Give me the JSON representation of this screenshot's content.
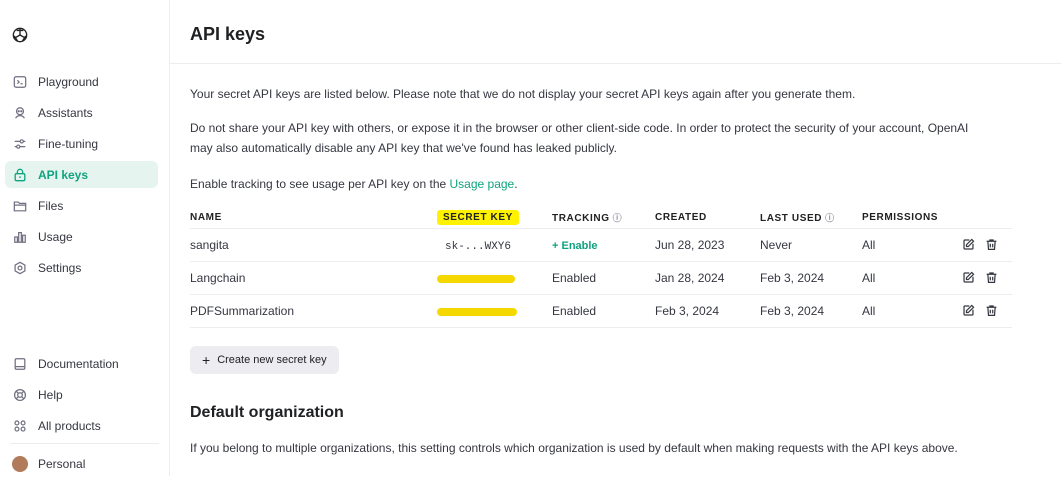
{
  "sidebar": {
    "items": [
      {
        "label": "Playground",
        "icon": "terminal-icon"
      },
      {
        "label": "Assistants",
        "icon": "robot-icon"
      },
      {
        "label": "Fine-tuning",
        "icon": "sliders-icon"
      },
      {
        "label": "API keys",
        "icon": "lock-icon",
        "active": true
      },
      {
        "label": "Files",
        "icon": "folder-icon"
      },
      {
        "label": "Usage",
        "icon": "bar-chart-icon"
      },
      {
        "label": "Settings",
        "icon": "gear-icon"
      }
    ],
    "bottom_items": [
      {
        "label": "Documentation",
        "icon": "document-icon"
      },
      {
        "label": "Help",
        "icon": "help-icon"
      },
      {
        "label": "All products",
        "icon": "grid-icon"
      }
    ],
    "account": {
      "label": "Personal"
    }
  },
  "page": {
    "title": "API keys",
    "intro": "Your secret API keys are listed below. Please note that we do not display your secret API keys again after you generate them.",
    "warning": "Do not share your API key with others, or expose it in the browser or other client-side code. In order to protect the security of your account, OpenAI may also automatically disable any API key that we've found has leaked publicly.",
    "tracking_prefix": "Enable tracking to see usage per API key on the ",
    "tracking_link": "Usage page",
    "tracking_suffix": "."
  },
  "table": {
    "headers": {
      "name": "NAME",
      "secret_key": "SECRET KEY",
      "tracking": "TRACKING",
      "created": "CREATED",
      "last_used": "LAST USED",
      "permissions": "PERMISSIONS"
    },
    "rows": [
      {
        "name": "sangita",
        "secret_key": "sk-...WXY6",
        "key_redacted": false,
        "tracking": "+ Enable",
        "tracking_is_action": true,
        "created": "Jun 28, 2023",
        "last_used": "Never",
        "permissions": "All"
      },
      {
        "name": "Langchain",
        "secret_key": "",
        "key_redacted": true,
        "tracking": "Enabled",
        "tracking_is_action": false,
        "created": "Jan 28, 2024",
        "last_used": "Feb 3, 2024",
        "permissions": "All"
      },
      {
        "name": "PDFSummarization",
        "secret_key": "",
        "key_redacted": true,
        "tracking": "Enabled",
        "tracking_is_action": false,
        "created": "Feb 3, 2024",
        "last_used": "Feb 3, 2024",
        "permissions": "All"
      }
    ]
  },
  "create_button": {
    "label": "Create new secret key"
  },
  "default_org": {
    "title": "Default organization",
    "description": "If you belong to multiple organizations, this setting controls which organization is used by default when making requests with the API keys above."
  },
  "colors": {
    "accent": "#10a37f",
    "highlight": "#fff200",
    "active_bg": "#e6f4ef"
  }
}
